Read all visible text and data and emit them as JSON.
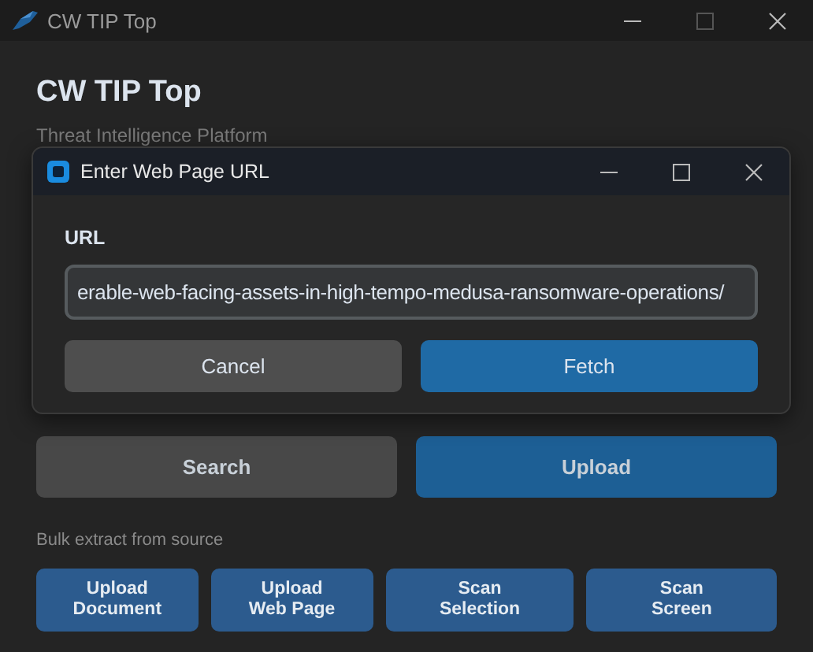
{
  "window": {
    "title": "CW TIP Top"
  },
  "header": {
    "title": "CW TIP Top",
    "subtitle": "Threat Intelligence Platform"
  },
  "actions": [
    {
      "label": "Search",
      "kind": "secondary"
    },
    {
      "label": "Upload",
      "kind": "primary"
    }
  ],
  "bulk": {
    "label": "Bulk extract from source",
    "buttons": [
      {
        "lines": [
          "Upload",
          "Document"
        ]
      },
      {
        "lines": [
          "Upload",
          "Web Page"
        ]
      },
      {
        "lines": [
          "Scan",
          "Selection"
        ]
      },
      {
        "lines": [
          "Scan",
          "Screen"
        ]
      }
    ]
  },
  "dialog": {
    "title": "Enter Web Page URL",
    "field_label": "URL",
    "value": "erable-web-facing-assets-in-high-tempo-medusa-ransomware-operations/",
    "buttons": [
      {
        "label": "Cancel",
        "kind": "secondary"
      },
      {
        "label": "Fetch",
        "kind": "primary"
      }
    ]
  }
}
